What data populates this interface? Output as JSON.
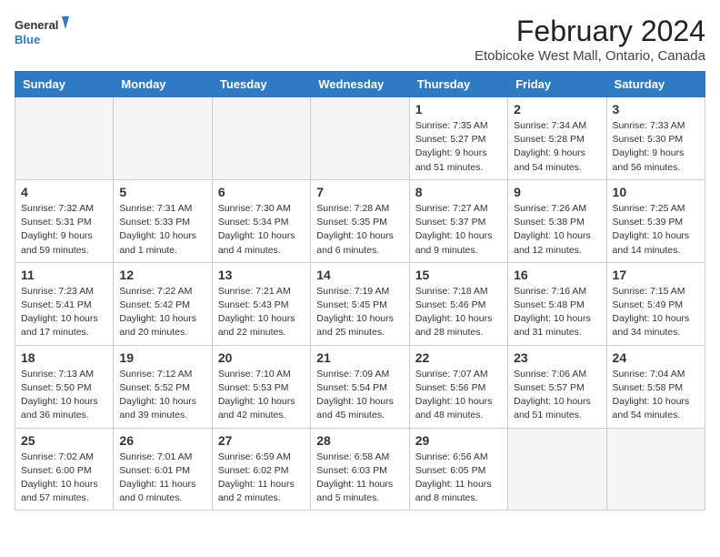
{
  "logo": {
    "line1": "General",
    "line2": "Blue"
  },
  "title": "February 2024",
  "subtitle": "Etobicoke West Mall, Ontario, Canada",
  "days_of_week": [
    "Sunday",
    "Monday",
    "Tuesday",
    "Wednesday",
    "Thursday",
    "Friday",
    "Saturday"
  ],
  "weeks": [
    [
      {
        "num": "",
        "info": ""
      },
      {
        "num": "",
        "info": ""
      },
      {
        "num": "",
        "info": ""
      },
      {
        "num": "",
        "info": ""
      },
      {
        "num": "1",
        "info": "Sunrise: 7:35 AM\nSunset: 5:27 PM\nDaylight: 9 hours\nand 51 minutes."
      },
      {
        "num": "2",
        "info": "Sunrise: 7:34 AM\nSunset: 5:28 PM\nDaylight: 9 hours\nand 54 minutes."
      },
      {
        "num": "3",
        "info": "Sunrise: 7:33 AM\nSunset: 5:30 PM\nDaylight: 9 hours\nand 56 minutes."
      }
    ],
    [
      {
        "num": "4",
        "info": "Sunrise: 7:32 AM\nSunset: 5:31 PM\nDaylight: 9 hours\nand 59 minutes."
      },
      {
        "num": "5",
        "info": "Sunrise: 7:31 AM\nSunset: 5:33 PM\nDaylight: 10 hours\nand 1 minute."
      },
      {
        "num": "6",
        "info": "Sunrise: 7:30 AM\nSunset: 5:34 PM\nDaylight: 10 hours\nand 4 minutes."
      },
      {
        "num": "7",
        "info": "Sunrise: 7:28 AM\nSunset: 5:35 PM\nDaylight: 10 hours\nand 6 minutes."
      },
      {
        "num": "8",
        "info": "Sunrise: 7:27 AM\nSunset: 5:37 PM\nDaylight: 10 hours\nand 9 minutes."
      },
      {
        "num": "9",
        "info": "Sunrise: 7:26 AM\nSunset: 5:38 PM\nDaylight: 10 hours\nand 12 minutes."
      },
      {
        "num": "10",
        "info": "Sunrise: 7:25 AM\nSunset: 5:39 PM\nDaylight: 10 hours\nand 14 minutes."
      }
    ],
    [
      {
        "num": "11",
        "info": "Sunrise: 7:23 AM\nSunset: 5:41 PM\nDaylight: 10 hours\nand 17 minutes."
      },
      {
        "num": "12",
        "info": "Sunrise: 7:22 AM\nSunset: 5:42 PM\nDaylight: 10 hours\nand 20 minutes."
      },
      {
        "num": "13",
        "info": "Sunrise: 7:21 AM\nSunset: 5:43 PM\nDaylight: 10 hours\nand 22 minutes."
      },
      {
        "num": "14",
        "info": "Sunrise: 7:19 AM\nSunset: 5:45 PM\nDaylight: 10 hours\nand 25 minutes."
      },
      {
        "num": "15",
        "info": "Sunrise: 7:18 AM\nSunset: 5:46 PM\nDaylight: 10 hours\nand 28 minutes."
      },
      {
        "num": "16",
        "info": "Sunrise: 7:16 AM\nSunset: 5:48 PM\nDaylight: 10 hours\nand 31 minutes."
      },
      {
        "num": "17",
        "info": "Sunrise: 7:15 AM\nSunset: 5:49 PM\nDaylight: 10 hours\nand 34 minutes."
      }
    ],
    [
      {
        "num": "18",
        "info": "Sunrise: 7:13 AM\nSunset: 5:50 PM\nDaylight: 10 hours\nand 36 minutes."
      },
      {
        "num": "19",
        "info": "Sunrise: 7:12 AM\nSunset: 5:52 PM\nDaylight: 10 hours\nand 39 minutes."
      },
      {
        "num": "20",
        "info": "Sunrise: 7:10 AM\nSunset: 5:53 PM\nDaylight: 10 hours\nand 42 minutes."
      },
      {
        "num": "21",
        "info": "Sunrise: 7:09 AM\nSunset: 5:54 PM\nDaylight: 10 hours\nand 45 minutes."
      },
      {
        "num": "22",
        "info": "Sunrise: 7:07 AM\nSunset: 5:56 PM\nDaylight: 10 hours\nand 48 minutes."
      },
      {
        "num": "23",
        "info": "Sunrise: 7:06 AM\nSunset: 5:57 PM\nDaylight: 10 hours\nand 51 minutes."
      },
      {
        "num": "24",
        "info": "Sunrise: 7:04 AM\nSunset: 5:58 PM\nDaylight: 10 hours\nand 54 minutes."
      }
    ],
    [
      {
        "num": "25",
        "info": "Sunrise: 7:02 AM\nSunset: 6:00 PM\nDaylight: 10 hours\nand 57 minutes."
      },
      {
        "num": "26",
        "info": "Sunrise: 7:01 AM\nSunset: 6:01 PM\nDaylight: 11 hours\nand 0 minutes."
      },
      {
        "num": "27",
        "info": "Sunrise: 6:59 AM\nSunset: 6:02 PM\nDaylight: 11 hours\nand 2 minutes."
      },
      {
        "num": "28",
        "info": "Sunrise: 6:58 AM\nSunset: 6:03 PM\nDaylight: 11 hours\nand 5 minutes."
      },
      {
        "num": "29",
        "info": "Sunrise: 6:56 AM\nSunset: 6:05 PM\nDaylight: 11 hours\nand 8 minutes."
      },
      {
        "num": "",
        "info": ""
      },
      {
        "num": "",
        "info": ""
      }
    ]
  ]
}
